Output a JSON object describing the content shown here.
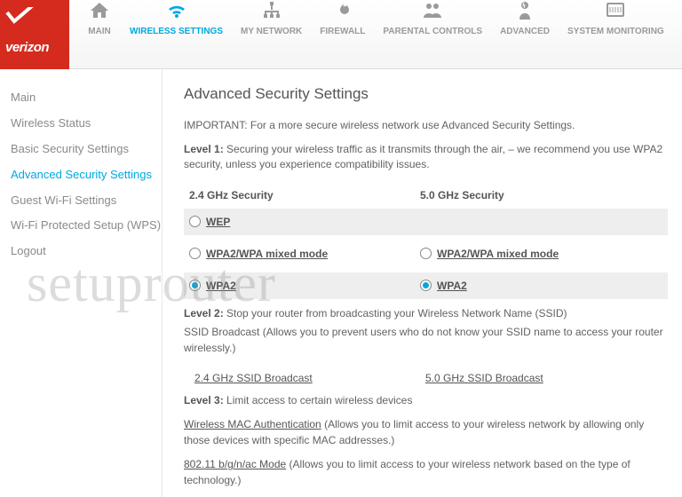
{
  "logo_text": "verizon",
  "nav": [
    {
      "label": "MAIN"
    },
    {
      "label": "WIRELESS SETTINGS"
    },
    {
      "label": "MY NETWORK"
    },
    {
      "label": "FIREWALL"
    },
    {
      "label": "PARENTAL CONTROLS"
    },
    {
      "label": "ADVANCED"
    },
    {
      "label": "SYSTEM MONITORING"
    }
  ],
  "sidebar": [
    "Main",
    "Wireless Status",
    "Basic Security Settings",
    "Advanced Security Settings",
    "Guest Wi-Fi Settings",
    "Wi-Fi Protected Setup (WPS)",
    "Logout"
  ],
  "page_title": "Advanced Security Settings",
  "important": "IMPORTANT: For a more secure wireless network use Advanced Security Settings.",
  "level1_bold": "Level 1:",
  "level1_text": " Securing your wireless traffic as it transmits through the air, – we recommend you use WPA2 security, unless you experience compatibility issues.",
  "col24": "2.4 GHz Security",
  "col50": "5.0 GHz Security",
  "wep": "WEP",
  "wpa_mixed": "WPA2/WPA mixed mode",
  "wpa2": "WPA2",
  "level2_bold": "Level 2:",
  "level2_text": " Stop your router from broadcasting your Wireless Network Name (SSID)",
  "level2_sub": "SSID Broadcast (Allows you to prevent users who do not know your SSID name to access your router wirelessly.)",
  "ssid24": "2.4 GHz SSID Broadcast",
  "ssid50": "5.0 GHz SSID Broadcast",
  "level3_bold": "Level 3:",
  "level3_text": " Limit access to certain wireless devices",
  "mac_link": "Wireless MAC Authentication",
  "mac_text": " (Allows you to limit access to your wireless network by allowing only those devices with specific MAC addresses.)",
  "mode_link": "802.11 b/g/n/ac Mode",
  "mode_text": " (Allows you to limit access to your wireless network based on the type of technology.)",
  "watermark": "setuprouter"
}
